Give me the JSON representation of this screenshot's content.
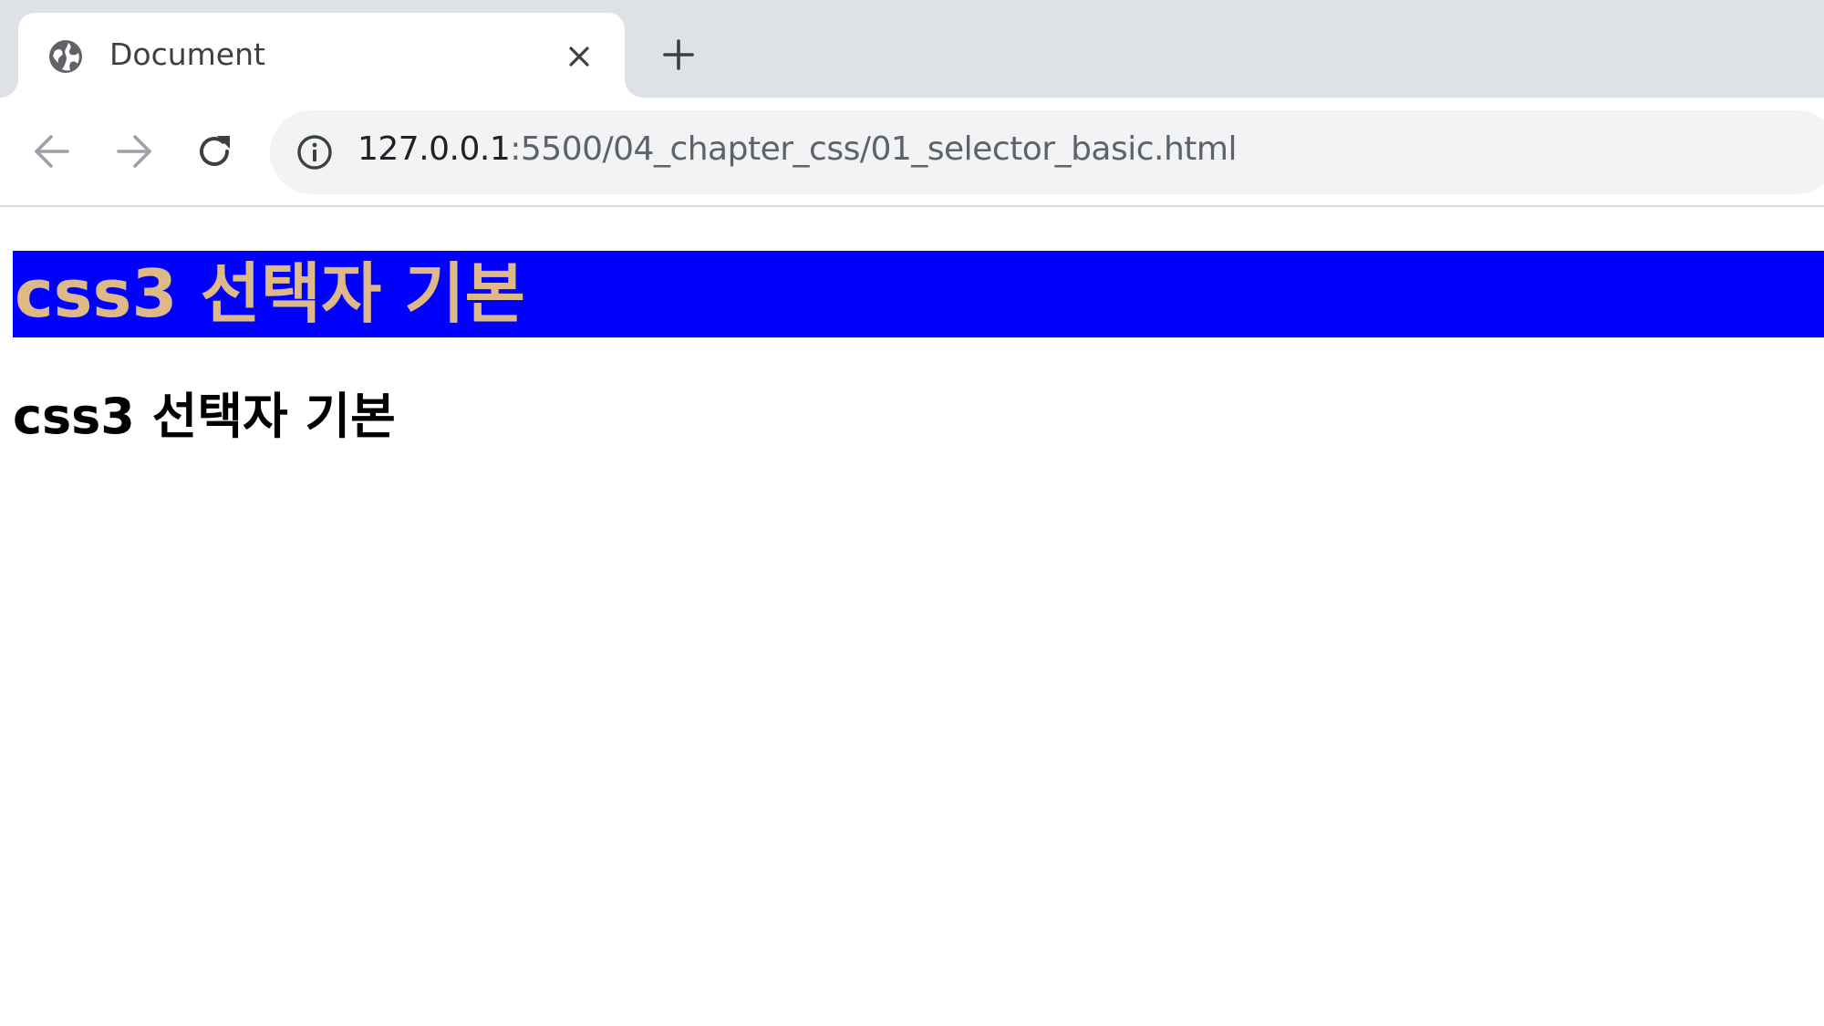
{
  "browser": {
    "tab": {
      "title": "Document",
      "favicon": "globe-icon"
    },
    "new_tab_icon": "plus-icon",
    "close_tab_icon": "close-icon",
    "nav": {
      "back_icon": "arrow-left-icon",
      "forward_icon": "arrow-right-icon",
      "reload_icon": "reload-icon"
    },
    "address_bar": {
      "security_icon": "info-icon",
      "url_host": "127.0.0.1",
      "url_rest": ":5500/04_chapter_css/01_selector_basic.html"
    }
  },
  "page": {
    "heading_styled": "css3 선택자 기본",
    "heading_plain": "css3 선택자 기본"
  },
  "colors": {
    "tabstrip": "#dee1e6",
    "omnibox": "#f1f3f4",
    "heading_background": "#0000ff",
    "heading_text": "#deb887",
    "plain_text": "#000000"
  }
}
